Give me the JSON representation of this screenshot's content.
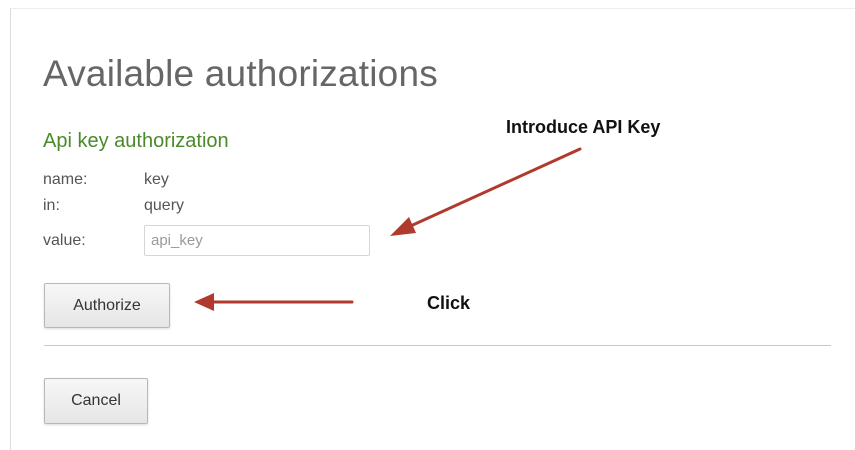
{
  "dialog": {
    "title": "Available authorizations",
    "section_title": "Api key authorization",
    "fields": {
      "name_label": "name:",
      "name_value": "key",
      "in_label": "in:",
      "in_value": "query",
      "value_label": "value:",
      "value_placeholder": "api_key",
      "value_current": ""
    },
    "authorize_label": "Authorize",
    "cancel_label": "Cancel"
  },
  "annotations": {
    "introduce": "Introduce API Key",
    "click": "Click",
    "arrow_color": "#b03a2e"
  },
  "colors": {
    "section_title": "#4a8a2a",
    "title": "#666666"
  }
}
